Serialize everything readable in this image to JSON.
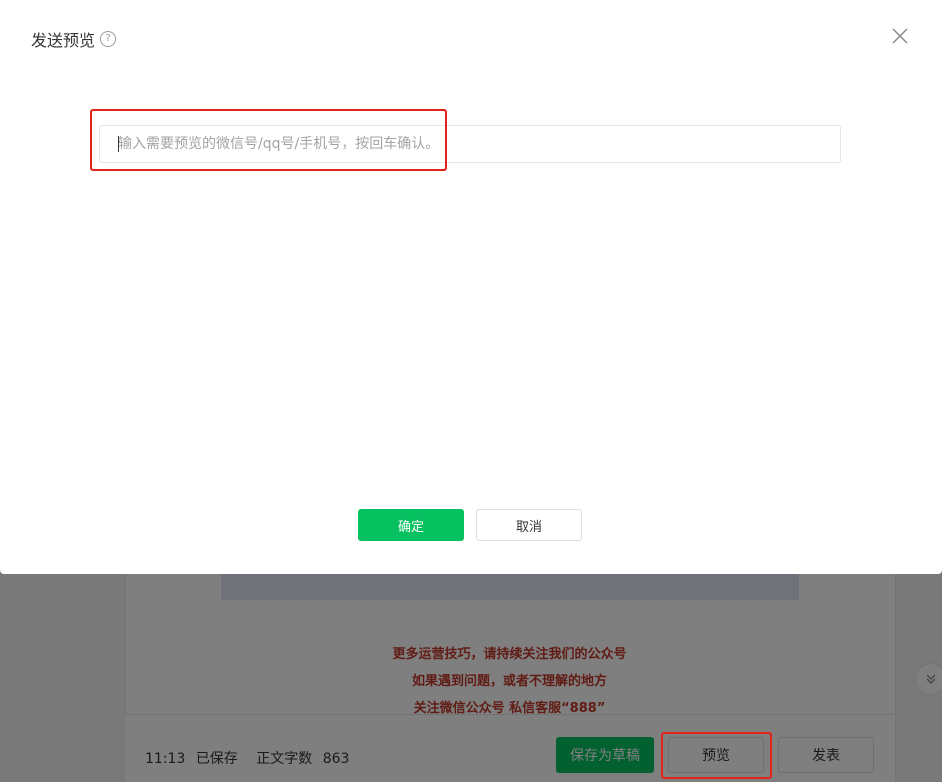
{
  "dialog": {
    "title": "发送预览",
    "help_icon": "question-circle-icon",
    "close_icon": "close-icon",
    "input_placeholder": "输入需要预览的微信号/qq号/手机号，按回车确认。",
    "confirm_label": "确定",
    "cancel_label": "取消",
    "accent_color": "#07c160"
  },
  "article": {
    "promo_lines": [
      "更多运营技巧，请持续关注我们的公众号",
      "如果遇到问题，或者不理解的地方",
      "关注微信公众号 私信客服“888”"
    ],
    "promo_color": "#c0392b"
  },
  "bottom_bar": {
    "time": "11:13",
    "saved_label": "已保存",
    "word_count_label": "正文字数",
    "word_count": "863",
    "save_draft_label": "保存为草稿",
    "preview_label": "预览",
    "publish_label": "发表"
  },
  "scroll_down_icon": "double-chevron-down-icon",
  "highlight_color": "#e2231a"
}
